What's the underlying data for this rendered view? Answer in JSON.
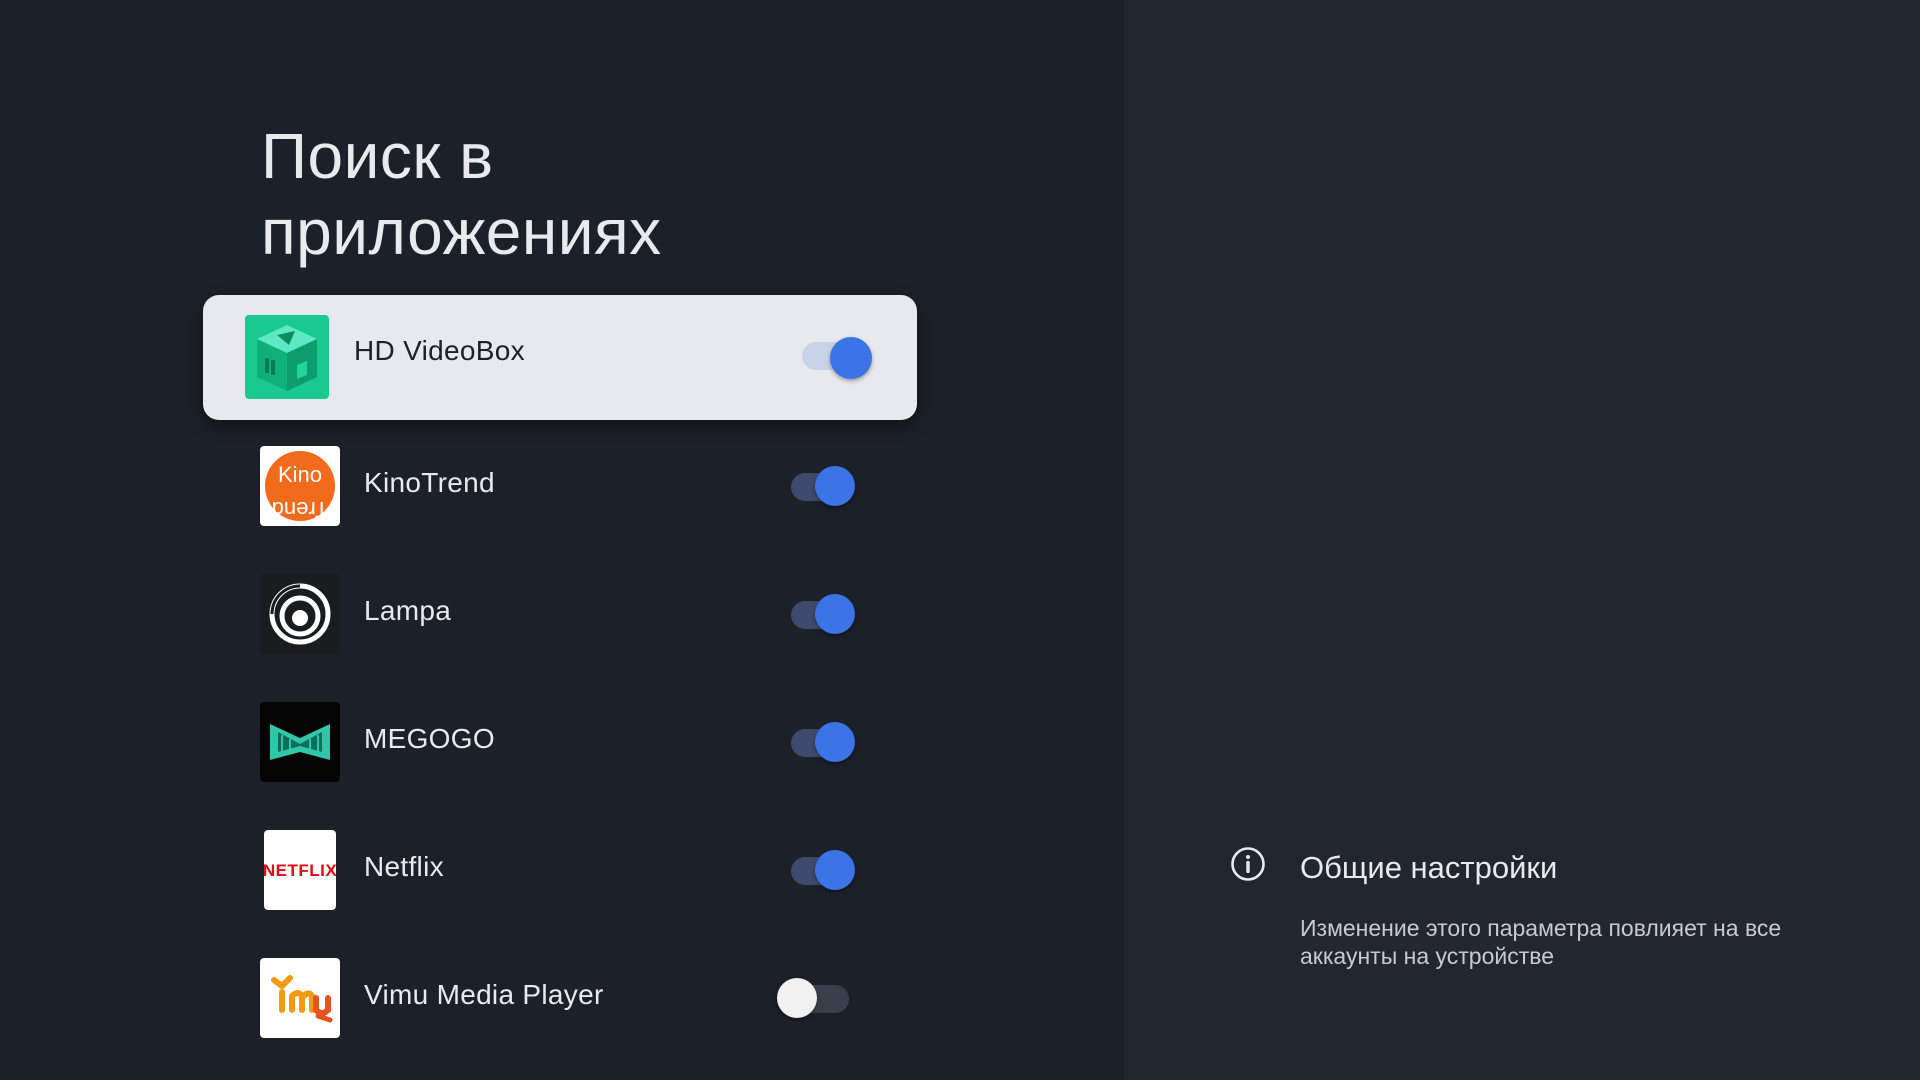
{
  "page": {
    "title": "Поиск в приложениях"
  },
  "apps": [
    {
      "name": "HD VideoBox",
      "enabled": true,
      "focused": true,
      "icon": "hd-videobox-icon"
    },
    {
      "name": "KinoTrend",
      "enabled": true,
      "focused": false,
      "icon": "kinotrend-icon"
    },
    {
      "name": "Lampa",
      "enabled": true,
      "focused": false,
      "icon": "lampa-icon"
    },
    {
      "name": "MEGOGO",
      "enabled": true,
      "focused": false,
      "icon": "megogo-icon"
    },
    {
      "name": "Netflix",
      "enabled": true,
      "focused": false,
      "icon": "netflix-icon"
    },
    {
      "name": "Vimu Media Player",
      "enabled": false,
      "focused": false,
      "icon": "vimu-icon"
    }
  ],
  "info": {
    "icon": "info-icon",
    "title": "Общие настройки",
    "description": "Изменение этого параметра повлияет на все аккаунты на устройстве"
  },
  "icon_text": {
    "kinotrend_top": "Kino",
    "kinotrend_bottom": "Trend",
    "netflix": "NETFLIX"
  },
  "colors": {
    "accent": "#3b74e6",
    "background_left": "#1c2028",
    "background_right": "#22262f",
    "focus_card": "#e8e9ee"
  }
}
